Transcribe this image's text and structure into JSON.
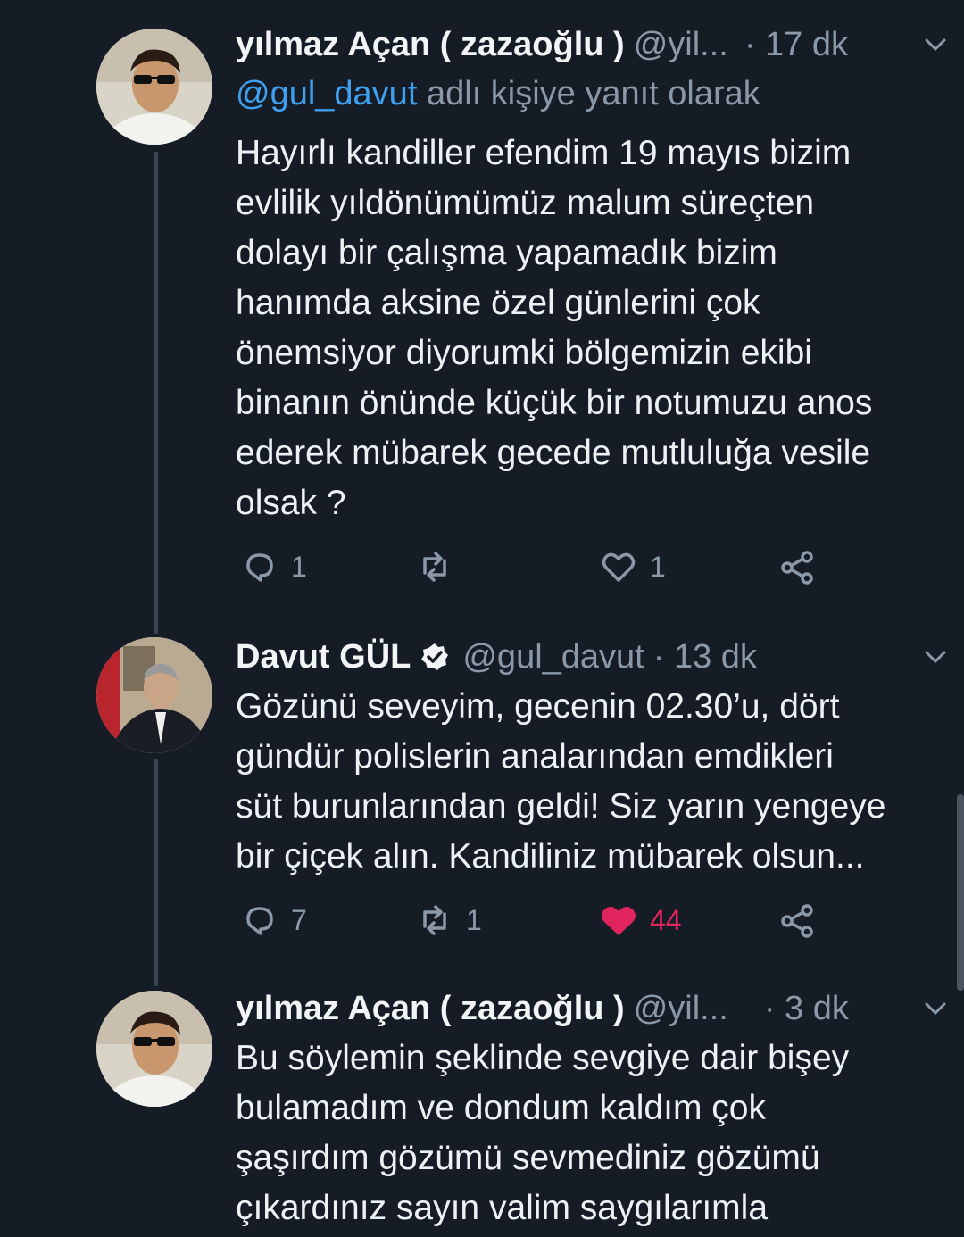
{
  "tweets": [
    {
      "name": "yılmaz Açan ( zazaoğlu )",
      "handle": "@yil...",
      "time": "· 17 dk",
      "reply_prefix": "@gul_davut",
      "reply_suffix": " adlı kişiye yanıt olarak",
      "text": "Hayırlı kandiller efendim  19 mayıs bizim\nevlilik yıldönümümüz malum süreçten\ndolayı bir çalışma yapamadık bizim\nhanımda aksine özel günlerini çok\nönemsiyor diyorumki  bölgemizin ekibi\nbinanın önünde küçük bir notumuzu  anos\nederek mübarek gecede mutluluğa vesile\nolsak ?",
      "replies": "1",
      "retweets": "",
      "likes": "1"
    },
    {
      "name": "Davut GÜL",
      "handle": "@gul_davut",
      "time": "· 13 dk",
      "text": "Gözünü seveyim, gecenin 02.30’u, dört\ngündür polislerin analarından emdikleri\nsüt burunlarından geldi! Siz yarın yengeye\nbir çiçek alın. Kandiliniz mübarek olsun...",
      "replies": "7",
      "retweets": "1",
      "likes": "44"
    },
    {
      "name": "yılmaz Açan ( zazaoğlu )",
      "handle": "@yil...",
      "time": "· 3 dk",
      "text": "Bu söylemin şeklinde sevgiye dair bişey\nbulamadım ve dondum kaldım çok\nşaşırdım gözümü sevmediniz gözümü\nçıkardınız sayın valim saygılarımla"
    }
  ],
  "icons": {
    "reply": "reply-icon",
    "retweet": "retweet-icon",
    "like": "heart-icon",
    "share": "share-icon",
    "more": "chevron-down-icon",
    "verified": "verified-badge-icon"
  },
  "colors": {
    "background": "#151c26",
    "link": "#3ea0ee",
    "muted": "#8a98a8",
    "like": "#e0245e"
  }
}
